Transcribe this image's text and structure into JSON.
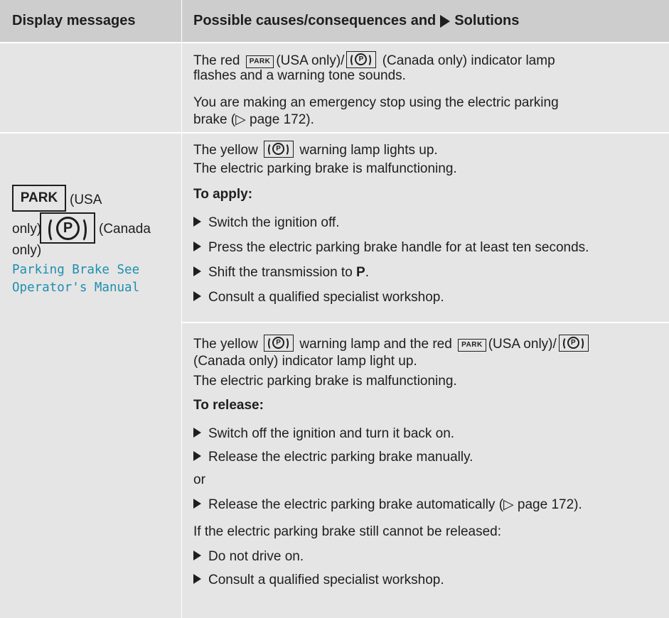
{
  "colors": {
    "header_bg": "#cdcdcd",
    "cell_bg": "#e5e5e5",
    "display_message_color": "#1e8fb0"
  },
  "header": {
    "display_messages": "Display messages",
    "causes_prefix": "Possible causes/consequences and",
    "causes_suffix": "Solutions"
  },
  "indicators": {
    "park": "PARK",
    "p_symbol": "P"
  },
  "row1": {
    "line1_a": "The red",
    "line1_b": "(USA only)/",
    "line1_c": "(Canada only) indicator lamp",
    "line2": "flashes and a warning tone sounds.",
    "line3": "You are making an emergency stop using the electric parking",
    "line4": "brake (▷ page 172)."
  },
  "row2_left": {
    "usa": "(USA",
    "only1": "only)",
    "canada": "(Canada",
    "only2": "only)",
    "msg_line1": "Parking Brake See",
    "msg_line2": "Operator's Manual"
  },
  "row2a": {
    "line1_a": "The yellow",
    "line1_b": "warning lamp lights up.",
    "line2": "The electric parking brake is malfunctioning.",
    "heading": "To apply:",
    "steps": [
      "Switch the ignition off.",
      "Press the electric parking brake handle for at least ten seconds.",
      "Shift the transmission to ",
      "Consult a qualified specialist workshop."
    ],
    "step3_bold": "P",
    "step3_end": "."
  },
  "row2b": {
    "line1_a": "The yellow",
    "line1_b": "warning lamp and the red",
    "line1_c": "(USA only)/",
    "line2": "(Canada only) indicator lamp light up.",
    "line3": "The electric parking brake is malfunctioning.",
    "heading": "To release:",
    "step1": "Switch off the ignition and turn it back on.",
    "step2": "Release the electric parking brake manually.",
    "or": "or",
    "step3": "Release the electric parking brake automatically (▷ page 172).",
    "note": "If the electric parking brake still cannot be released:",
    "step4": "Do not drive on.",
    "step5": "Consult a qualified specialist workshop."
  }
}
